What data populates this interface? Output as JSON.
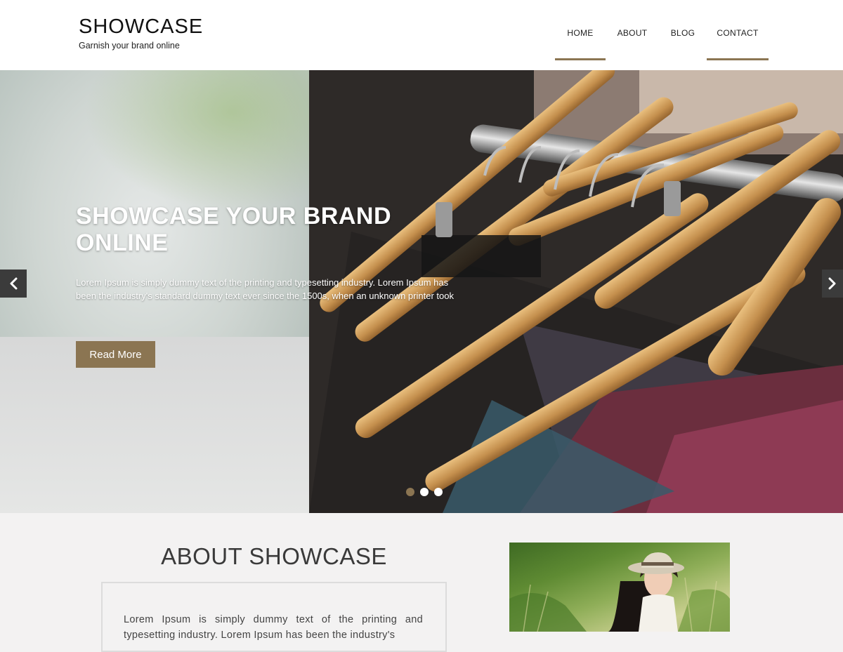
{
  "header": {
    "site_title": "SHOWCASE",
    "tagline": "Garnish your brand online",
    "nav": [
      {
        "label": "HOME",
        "active": true
      },
      {
        "label": "ABOUT",
        "active": false
      },
      {
        "label": "BLOG",
        "active": false
      },
      {
        "label": "CONTACT",
        "active": true
      }
    ]
  },
  "hero": {
    "title": "SHOWCASE YOUR BRAND ONLINE",
    "text": "Lorem Ipsum is simply dummy text of the printing and typesetting industry. Lorem Ipsum has been the industry's standard dummy text ever since the 1500s, when an unknown printer took",
    "button_label": "Read More",
    "prev_icon": "chevron-left-icon",
    "next_icon": "chevron-right-icon",
    "slides_count": 3,
    "active_slide": 1
  },
  "about": {
    "title": "ABOUT SHOWCASE",
    "text": "Lorem Ipsum is simply dummy text of the printing and typesetting industry. Lorem Ipsum has been the industry's"
  },
  "colors": {
    "accent": "#8b7552",
    "header_bg": "#ffffff",
    "section_bg": "#f3f2f2"
  }
}
